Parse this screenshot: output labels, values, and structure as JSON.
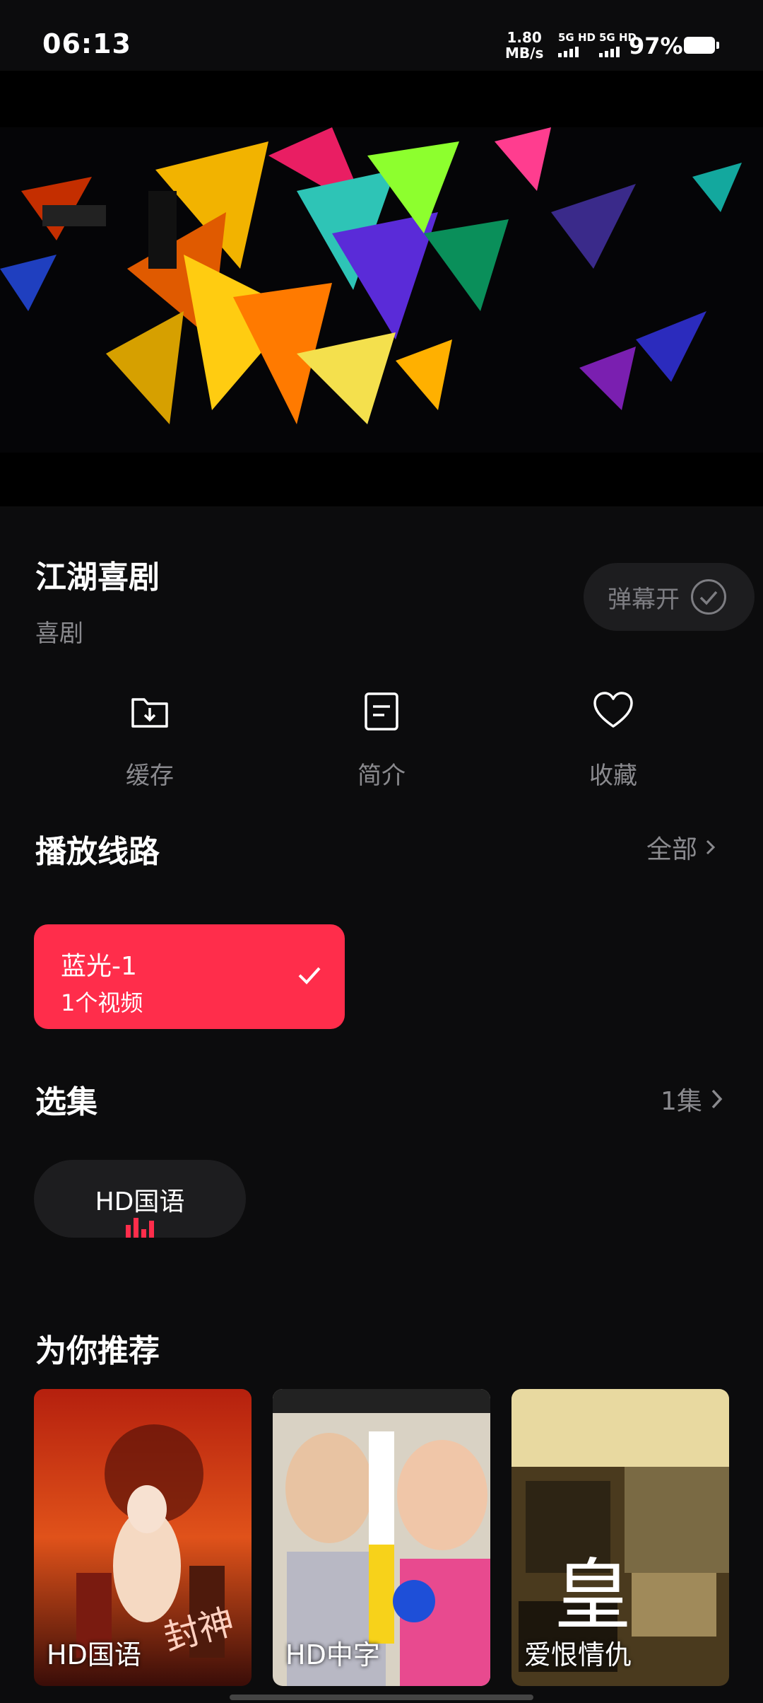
{
  "status_bar": {
    "time": "06:13",
    "net_speed_value": "1.80",
    "net_speed_unit": "MB/s",
    "sim1": "5G HD",
    "sim2": "5G HD",
    "battery": "97%"
  },
  "video": {
    "player_label": "video-frame"
  },
  "movie": {
    "title": "江湖喜剧",
    "genre": "喜剧",
    "danmaku_label": "弹幕开"
  },
  "actions": [
    {
      "label": "缓存",
      "icon": "download-folder-icon"
    },
    {
      "label": "简介",
      "icon": "document-icon"
    },
    {
      "label": "收藏",
      "icon": "heart-icon"
    }
  ],
  "routes": {
    "title": "播放线路",
    "more": "全部",
    "items": [
      {
        "name": "蓝光-1",
        "count": "1个视频"
      }
    ]
  },
  "episodes": {
    "title": "选集",
    "more": "1集",
    "items": [
      {
        "label": "HD国语"
      }
    ]
  },
  "recommend": {
    "title": "为你推荐",
    "items": [
      {
        "caption": "HD国语"
      },
      {
        "caption": "HD中字"
      },
      {
        "caption": "爱恨情仇"
      }
    ]
  },
  "colors": {
    "accent": "#ff2d4b",
    "background": "#0c0c0d",
    "muted": "#8a8a8e"
  }
}
